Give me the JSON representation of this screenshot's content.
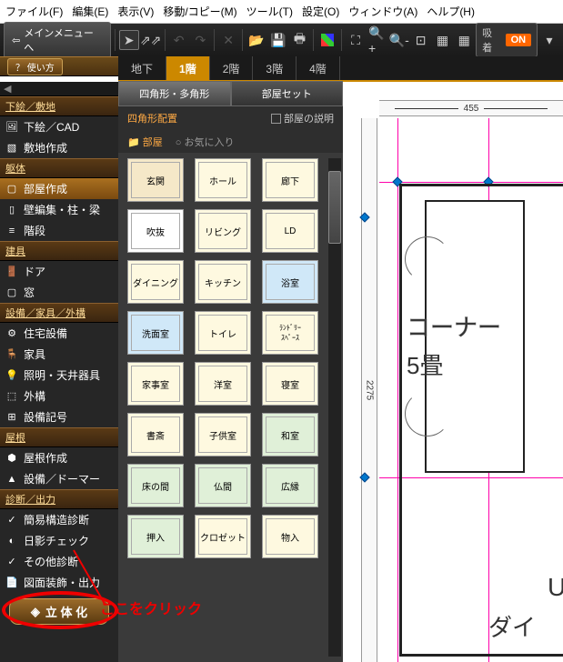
{
  "menu": {
    "file": "ファイル(F)",
    "edit": "編集(E)",
    "view": "表示(V)",
    "move": "移動/コピー(M)",
    "tool": "ツール(T)",
    "setting": "設定(O)",
    "window": "ウィンドウ(A)",
    "help": "ヘルプ(H)"
  },
  "back_label": "メインメニューへ",
  "snap": {
    "label": "吸着",
    "state": "ON"
  },
  "help_btn": "？ 使い方",
  "sidebar": {
    "sections": [
      "下絵／敷地",
      "躯体",
      "建具",
      "設備／家具／外構",
      "屋根",
      "診断／出力"
    ],
    "items": {
      "s0": [
        {
          "l": "下絵／CAD"
        },
        {
          "l": "敷地作成"
        }
      ],
      "s1": [
        {
          "l": "部屋作成",
          "a": true
        },
        {
          "l": "壁編集・柱・梁"
        },
        {
          "l": "階段"
        }
      ],
      "s2": [
        {
          "l": "ドア"
        },
        {
          "l": "窓"
        }
      ],
      "s3": [
        {
          "l": "住宅設備"
        },
        {
          "l": "家具"
        },
        {
          "l": "照明・天井器具"
        },
        {
          "l": "外構"
        },
        {
          "l": "設備記号"
        }
      ],
      "s4": [
        {
          "l": "屋根作成"
        },
        {
          "l": "設備／ドーマー"
        }
      ],
      "s5": [
        {
          "l": "簡易構造診断"
        },
        {
          "l": "日影チェック"
        },
        {
          "l": "その他診断"
        },
        {
          "l": "図面装飾・出力"
        }
      ]
    },
    "render": "立 体 化"
  },
  "floors": [
    "地下",
    "1階",
    "2階",
    "3階",
    "4階"
  ],
  "active_floor": 1,
  "cat_tabs": [
    "四角形・多角形",
    "部屋セット"
  ],
  "subheader": {
    "label": "四角形配置",
    "check": "部屋の説明"
  },
  "folders": {
    "room": "部屋",
    "fav": "お気に入り"
  },
  "rooms": [
    [
      {
        "l": "玄関",
        "c": "c-beige"
      },
      {
        "l": "ホール",
        "c": "c-cream"
      },
      {
        "l": "廊下",
        "c": "c-cream"
      }
    ],
    [
      {
        "l": "吹抜",
        "c": ""
      },
      {
        "l": "リビング",
        "c": "c-cream"
      },
      {
        "l": "LD",
        "c": "c-cream"
      }
    ],
    [
      {
        "l": "ダイニング",
        "c": "c-cream"
      },
      {
        "l": "キッチン",
        "c": "c-cream"
      },
      {
        "l": "浴室",
        "c": "c-blue"
      }
    ],
    [
      {
        "l": "洗面室",
        "c": "c-blue"
      },
      {
        "l": "トイレ",
        "c": "c-cream"
      },
      {
        "l": "ﾗﾝﾄﾞﾘｰ\nｽﾍﾟｰｽ",
        "c": "c-cream"
      }
    ],
    [
      {
        "l": "家事室",
        "c": "c-cream"
      },
      {
        "l": "洋室",
        "c": "c-cream"
      },
      {
        "l": "寝室",
        "c": "c-cream"
      }
    ],
    [
      {
        "l": "書斎",
        "c": "c-cream"
      },
      {
        "l": "子供室",
        "c": "c-cream"
      },
      {
        "l": "和室",
        "c": "c-green"
      }
    ],
    [
      {
        "l": "床の間",
        "c": "c-green"
      },
      {
        "l": "仏間",
        "c": "c-green"
      },
      {
        "l": "広縁",
        "c": "c-green"
      }
    ],
    [
      {
        "l": "押入",
        "c": "c-green"
      },
      {
        "l": "クロゼット",
        "c": "c-cream"
      },
      {
        "l": "物入",
        "c": "c-cream"
      }
    ]
  ],
  "canvas": {
    "dim_h": "455",
    "dim_v": "2275",
    "label_corner": "コーナー",
    "label_size": "5畳",
    "label_u": "U",
    "label_dai": "ダイ"
  },
  "annotation": "ここをクリック"
}
